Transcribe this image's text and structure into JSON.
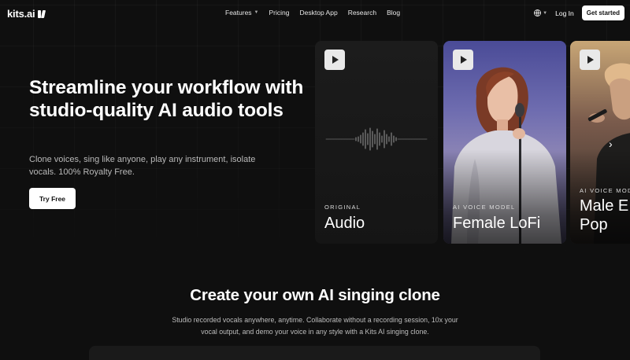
{
  "nav": {
    "logo_text": "kits.ai",
    "links": [
      "Features",
      "Pricing",
      "Desktop App",
      "Research",
      "Blog"
    ],
    "login": "Log In",
    "cta": "Get started"
  },
  "hero": {
    "title": "Streamline your workflow with studio-quality AI audio tools",
    "subtitle": "Clone voices, sing like anyone, play any instrument, isolate vocals. 100% Royalty Free.",
    "cta": "Try Free"
  },
  "cards": [
    {
      "label": "ORIGINAL",
      "title": "Audio"
    },
    {
      "label": "AI VOICE MODEL",
      "title": "Female LoFi"
    },
    {
      "label": "AI VOICE MODE",
      "title": "Male E Pop"
    }
  ],
  "section": {
    "title": "Create your own AI singing clone",
    "subtitle": "Studio recorded vocals anywhere, anytime. Collaborate without a recording session, 10x your vocal output, and demo your voice in any style with a Kits AI singing clone."
  },
  "icons": {
    "play": "play-icon",
    "globe": "globe-icon",
    "next": "chevron-right-icon"
  },
  "colors": {
    "background": "#0f0f0f",
    "card": "#1c1c1c",
    "button_bg": "#ffffff"
  }
}
